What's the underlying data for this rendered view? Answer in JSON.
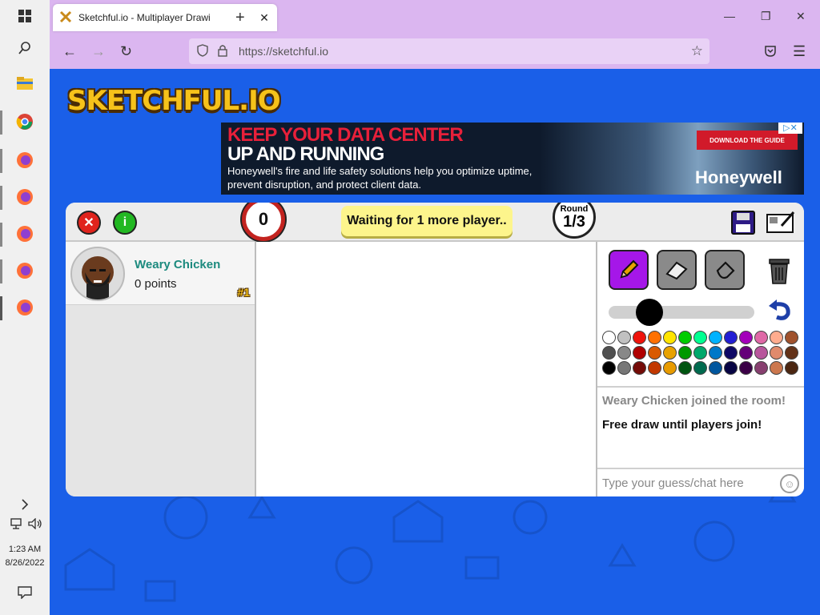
{
  "taskbar": {
    "time": "1:23 AM",
    "date": "8/26/2022"
  },
  "browser": {
    "tab_title": "Sketchful.io - Multiplayer Drawi",
    "url": "https://sketchful.io"
  },
  "site": {
    "logo": "SKETCHFUL.IO"
  },
  "ad": {
    "headline1": "KEEP YOUR DATA CENTER",
    "headline2": "UP AND RUNNING",
    "body": "Honeywell's fire and life safety solutions help you optimize uptime, prevent disruption, and protect client data.",
    "cta": "DOWNLOAD THE GUIDE",
    "brand": "Honeywell"
  },
  "game": {
    "timer": "0",
    "status": "Waiting for 1 more player..",
    "round_label": "Round",
    "round_value": "1/3",
    "players": [
      {
        "name": "Weary Chicken",
        "points": "0 points",
        "rank": "#1"
      }
    ],
    "palette": [
      [
        "#ffffff",
        "#c1c1c1",
        "#ef130b",
        "#ff7100",
        "#ffe400",
        "#00cc00",
        "#00ff91",
        "#00b2ff",
        "#231fd3",
        "#a300ba",
        "#df69a7",
        "#ffac8e",
        "#a0522d"
      ],
      [
        "#505050",
        "#888888",
        "#b00000",
        "#d95a00",
        "#e8a200",
        "#009900",
        "#00a86b",
        "#0078c8",
        "#0e0865",
        "#650079",
        "#b8569c",
        "#e08a6c",
        "#633218"
      ],
      [
        "#000000",
        "#777777",
        "#740b07",
        "#c23800",
        "#e89b00",
        "#005510",
        "#006a4e",
        "#00569e",
        "#070443",
        "#3b0047",
        "#873f6f",
        "#cc774d",
        "#4b2611"
      ]
    ],
    "chat": [
      {
        "text": "Weary Chicken joined the room!",
        "color": "#888888"
      },
      {
        "text": "Free draw until players join!",
        "color": "#111111"
      }
    ],
    "chat_placeholder": "Type your guess/chat here"
  }
}
